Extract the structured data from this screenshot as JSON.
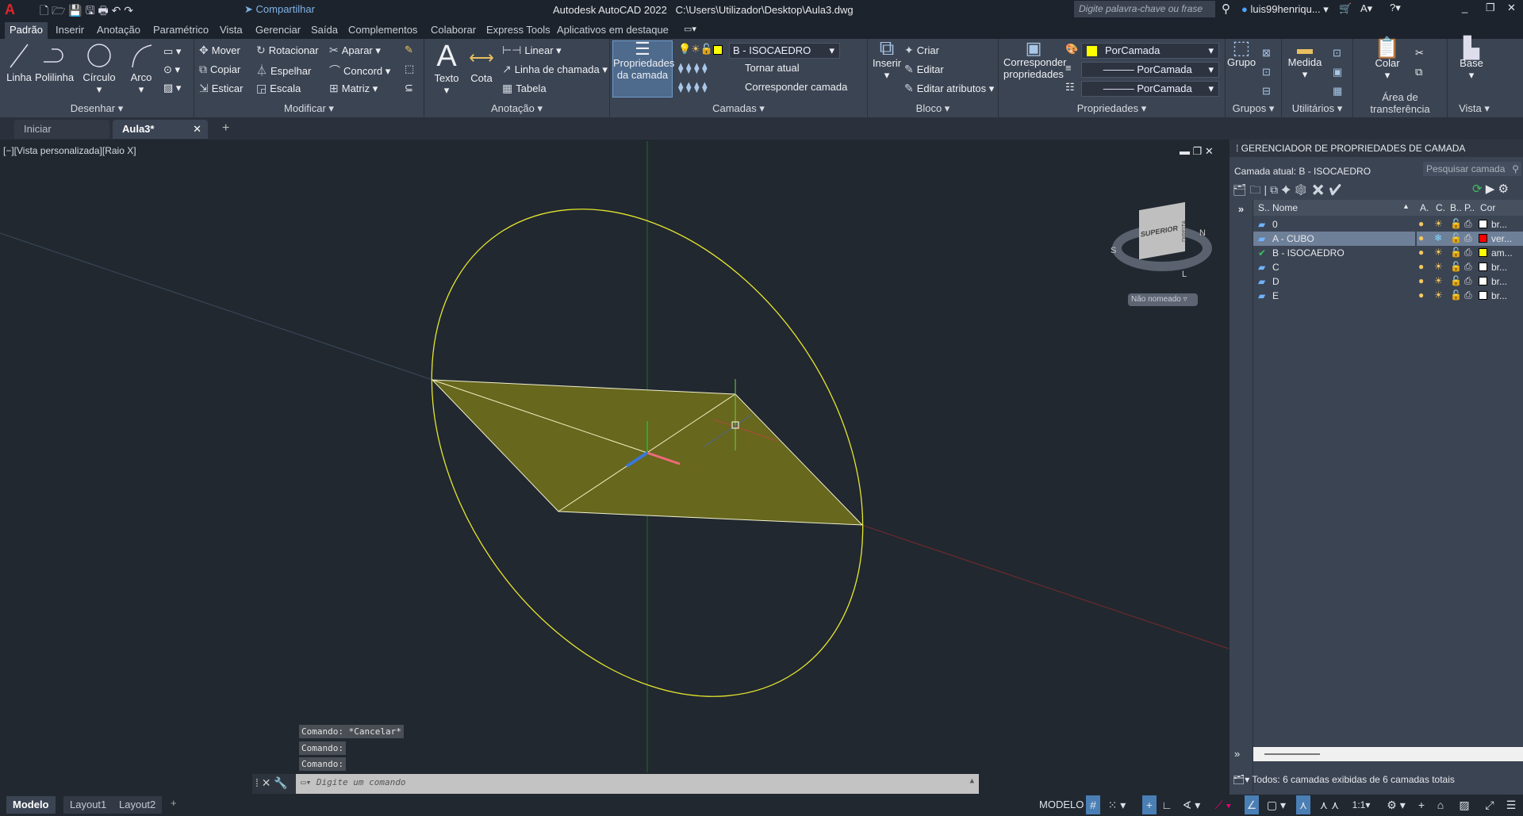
{
  "titlebar": {
    "app": "Autodesk AutoCAD 2022",
    "path": "C:\\Users\\Utilizador\\Desktop\\Aula3.dwg",
    "share": "Compartilhar",
    "search_placeholder": "Digite palavra-chave ou frase",
    "user": "luis99henriqu..."
  },
  "ribbon_tabs": [
    "Padrão",
    "Inserir",
    "Anotação",
    "Paramétrico",
    "Vista",
    "Gerenciar",
    "Saída",
    "Complementos",
    "Colaborar",
    "Express Tools",
    "Aplicativos em destaque"
  ],
  "ribbon": {
    "draw": {
      "title": "Desenhar",
      "linha": "Linha",
      "polilinha": "Polilinha",
      "circulo": "Círculo",
      "arco": "Arco"
    },
    "modify": {
      "title": "Modificar",
      "mover": "Mover",
      "rotacionar": "Rotacionar",
      "aparar": "Aparar",
      "copiar": "Copiar",
      "espelhar": "Espelhar",
      "concord": "Concord",
      "esticar": "Esticar",
      "escala": "Escala",
      "matriz": "Matriz"
    },
    "annotation": {
      "title": "Anotação",
      "texto": "Texto",
      "cota": "Cota",
      "linear": "Linear",
      "linha_chamada": "Linha de chamada",
      "tabela": "Tabela"
    },
    "layers": {
      "title": "Camadas",
      "props": "Propriedades da camada",
      "current": "B - ISOCAEDRO",
      "tornar": "Tornar atual",
      "corresp": "Corresponder camada"
    },
    "block": {
      "title": "Bloco",
      "inserir": "Inserir",
      "criar": "Criar",
      "editar": "Editar",
      "editar_atrib": "Editar atributos"
    },
    "properties": {
      "title": "Propriedades",
      "corresp": "Corresponder propriedades",
      "color": "PorCamada",
      "linetype": "PorCamada",
      "lineweight": "PorCamada"
    },
    "groups": {
      "title": "Grupos",
      "grupo": "Grupo"
    },
    "utilities": {
      "title": "Utilitários",
      "medida": "Medida"
    },
    "clipboard": {
      "title": "Área de transferência",
      "colar": "Colar"
    },
    "view": {
      "title": "Vista",
      "base": "Base"
    }
  },
  "doc_tabs": [
    "Iniciar",
    "Aula3*"
  ],
  "viewport": {
    "label": "[−][Vista personalizada][Raio X]",
    "viewcube_face": "SUPERIOR",
    "viewcube_side": "DIREITA",
    "compass": [
      "N",
      "S",
      "L"
    ],
    "ucs_menu": "Não nomeado"
  },
  "colors": {
    "ellipse": "#e6e62e",
    "face": "#6b6a1c",
    "x_axis": "#b03030",
    "y_axis": "#2fa82f"
  },
  "command": {
    "history": [
      "Comando: *Cancelar*",
      "Comando:",
      "Comando:"
    ],
    "placeholder": "Digite um comando"
  },
  "layer_manager": {
    "title": "GERENCIADOR DE PROPRIEDADES DE CAMADA",
    "current": "Camada atual: B - ISOCAEDRO",
    "search_placeholder": "Pesquisar camada",
    "columns": [
      "S..",
      "Nome",
      "A.",
      "C.",
      "B..",
      "P..",
      "Cor"
    ],
    "layers": [
      {
        "name": "0",
        "color": "#ffffff",
        "color_name": "br..."
      },
      {
        "name": "A - CUBO",
        "color": "#ff0000",
        "color_name": "ver...",
        "selected": true,
        "frozen": true
      },
      {
        "name": "B - ISOCAEDRO",
        "color": "#ffff00",
        "color_name": "am...",
        "current": true
      },
      {
        "name": "C",
        "color": "#ffffff",
        "color_name": "br..."
      },
      {
        "name": "D",
        "color": "#ffffff",
        "color_name": "br..."
      },
      {
        "name": "E",
        "color": "#ffffff",
        "color_name": "br..."
      }
    ],
    "footer": "Todos: 6 camadas exibidas de 6 camadas totais"
  },
  "layout_tabs": [
    "Modelo",
    "Layout1",
    "Layout2"
  ],
  "status": {
    "model": "MODELO",
    "scale": "1:1"
  }
}
